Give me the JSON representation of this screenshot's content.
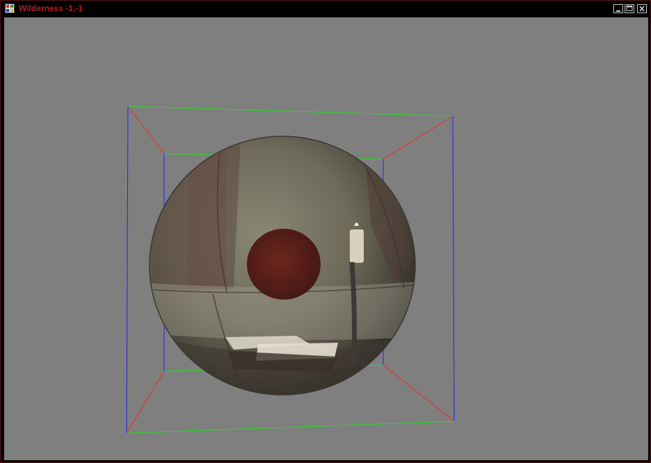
{
  "window": {
    "title": "Wilderness -1,-1",
    "title_color": "#b41e1e",
    "border_color": "#5a1414",
    "controls": [
      "minimize-icon",
      "maximize-icon",
      "close-icon"
    ]
  },
  "viewport": {
    "background": "#7f7f7f",
    "bounding_box_axis_colors": {
      "x": "#ff2020",
      "y": "#20ff20",
      "z": "#2020ff"
    }
  }
}
